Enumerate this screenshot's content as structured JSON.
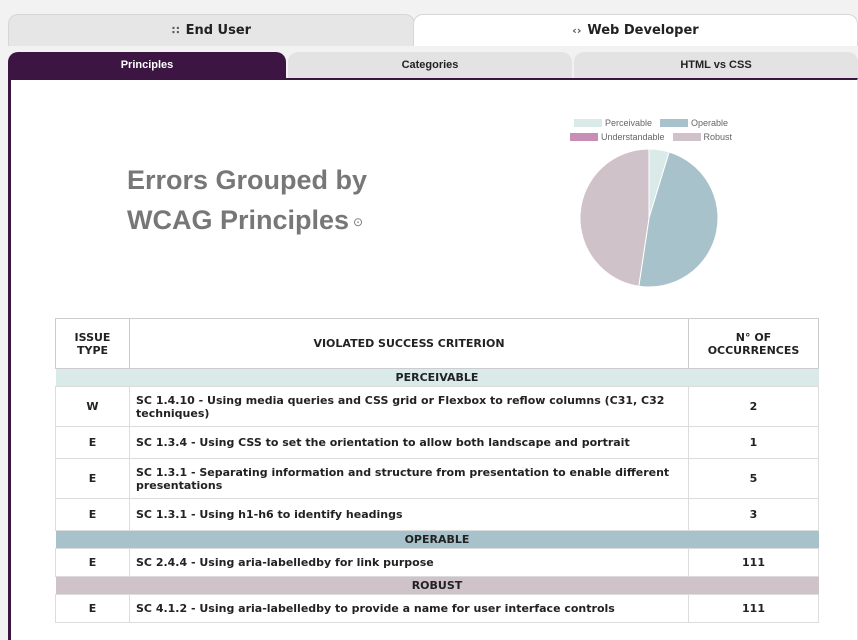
{
  "view_tabs": {
    "end_user": {
      "icon": "users-icon",
      "label": "End User"
    },
    "web_developer": {
      "icon": "code-icon",
      "label": "Web Developer"
    }
  },
  "sub_tabs": {
    "principles": "Principles",
    "categories": "Categories",
    "html_vs_css": "HTML vs CSS"
  },
  "section": {
    "title_line1": "Errors Grouped by",
    "title_line2": "WCAG Principles"
  },
  "chart_data": {
    "type": "pie",
    "labels": [
      "Perceivable",
      "Operable",
      "Understandable",
      "Robust"
    ],
    "values": [
      11,
      111,
      0,
      111
    ],
    "colors": [
      "#d9eae8",
      "#a8c2cb",
      "#c78fb5",
      "#cfc2c8"
    ],
    "legend_position": "top"
  },
  "table": {
    "headers": {
      "issue_type": "ISSUE TYPE",
      "criterion": "VIOLATED SUCCESS CRITERION",
      "occurrences": "N° OF OCCURRENCES"
    },
    "groups": {
      "perceivable": "PERCEIVABLE",
      "operable": "OPERABLE",
      "robust": "ROBUST"
    },
    "rows": [
      {
        "type": "W",
        "criterion": "SC 1.4.10 - Using media queries and CSS grid or Flexbox to reflow columns (C31, C32 techniques)",
        "count": "2"
      },
      {
        "type": "E",
        "criterion": "SC 1.3.4 - Using CSS to set the orientation to allow both landscape and portrait",
        "count": "1"
      },
      {
        "type": "E",
        "criterion": "SC 1.3.1 - Separating information and structure from presentation to enable different presentations",
        "count": "5"
      },
      {
        "type": "E",
        "criterion": "SC 1.3.1 - Using h1-h6 to identify headings",
        "count": "3"
      },
      {
        "type": "E",
        "criterion": "SC 2.4.4 - Using aria-labelledby for link purpose",
        "count": "111"
      },
      {
        "type": "E",
        "criterion": "SC 4.1.2 - Using aria-labelledby to provide a name for user interface controls",
        "count": "111"
      }
    ]
  }
}
